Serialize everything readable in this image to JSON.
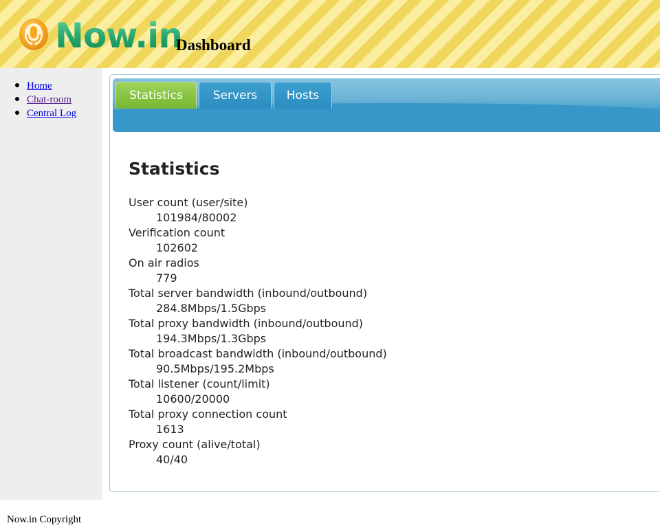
{
  "header": {
    "logo_text": "Now.in",
    "page_title": "Dashboard"
  },
  "sidebar": {
    "items": [
      {
        "label": "Home"
      },
      {
        "label": "Chat-room"
      },
      {
        "label": "Central Log"
      }
    ]
  },
  "tabs": [
    {
      "label": "Statistics",
      "active": true
    },
    {
      "label": "Servers",
      "active": false
    },
    {
      "label": "Hosts",
      "active": false
    }
  ],
  "statistics": {
    "title": "Statistics",
    "items": [
      {
        "label": "User count (user/site)",
        "value": "101984/80002"
      },
      {
        "label": "Verification count",
        "value": "102602"
      },
      {
        "label": "On air radios",
        "value": "779"
      },
      {
        "label": "Total server bandwidth (inbound/outbound)",
        "value": "284.8Mbps/1.5Gbps"
      },
      {
        "label": "Total proxy bandwidth (inbound/outbound)",
        "value": "194.3Mbps/1.3Gbps"
      },
      {
        "label": "Total broadcast bandwidth (inbound/outbound)",
        "value": "90.5Mbps/195.2Mbps"
      },
      {
        "label": "Total listener (count/limit)",
        "value": "10600/20000"
      },
      {
        "label": "Total proxy connection count",
        "value": "1613"
      },
      {
        "label": "Proxy count (alive/total)",
        "value": "40/40"
      }
    ]
  },
  "footer": {
    "text": "Now.in Copyright"
  },
  "colors": {
    "header_stripe_dark": "#f0d75c",
    "header_stripe_light": "#fbeea0",
    "logo_green": "#2ab27b",
    "logo_icon_orange": "#f5a623",
    "tab_active": "#85c240",
    "tab_bar_blue": "#3a98c8",
    "sidebar_bg": "#eeeeee",
    "link": "#0000ee",
    "link_visited": "#551a8b"
  },
  "icons": {
    "logo": "microphone-icon"
  }
}
